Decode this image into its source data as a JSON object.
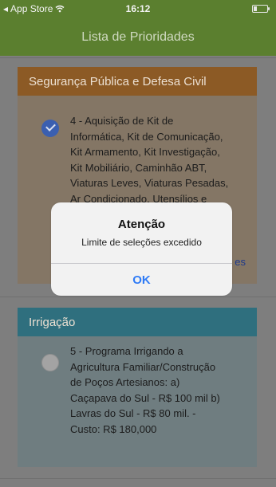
{
  "status_bar": {
    "back_app": "App Store",
    "time": "16:12"
  },
  "header": {
    "title": "Lista de Prioridades"
  },
  "sections": [
    {
      "title": "Segurança Pública e Defesa Civil",
      "item": {
        "selected": true,
        "text_lines": [
          "4 - Aquisição de Kit de",
          "Informática, Kit de Comunicação,",
          "Kit Armamento, Kit Investigação,",
          "Kit Mobiliário, Caminhão ABT,",
          "Viaturas Leves, Viaturas Pesadas,",
          "Ar Condicionado, Utensílios e"
        ],
        "more_link": "es"
      }
    },
    {
      "title": "Irrigação",
      "item": {
        "selected": false,
        "text_lines": [
          "5 - Programa Irrigando a",
          "Agricultura Familiar/Construção",
          "de Poços Artesianos: a)",
          "Caçapava do Sul - R$ 100 mil b)",
          "Lavras do Sul - R$ 80 mil. -",
          "Custo: R$ 180,000"
        ]
      }
    }
  ],
  "alert": {
    "title": "Atenção",
    "message": "Limite de seleções excedido",
    "ok_label": "OK"
  },
  "colors": {
    "header": "#5b7f2f",
    "alert_button": "#2f7bf6"
  }
}
